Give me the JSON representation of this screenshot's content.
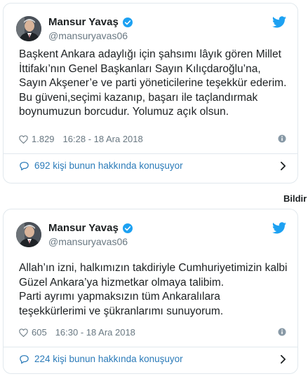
{
  "colors": {
    "accent": "#1da1f2",
    "link": "#2b7bb9",
    "muted": "#697882",
    "border": "#e1e8ed"
  },
  "icons": [
    "person-avatar",
    "verified-badge-icon",
    "twitter-bird-icon",
    "heart-icon",
    "info-icon",
    "speech-bubble-icon",
    "chevron-right-icon"
  ],
  "tweets": [
    {
      "name": "Mansur Yavaş",
      "handle": "@mansuryavas06",
      "lines": [
        "Başkent Ankara adaylığı için şahsımı lâyık gören Millet",
        "İttifakı’nın Genel Başkanları Sayın Kılıçdaroğlu’na,",
        "Sayın Akşener’e ve parti yöneticilerine teşekkür ederim.",
        "Bu güveni,seçimi kazanıp, başarı ile taçlandırmak",
        "boynumuzun borcudur.  Yolumuz açık olsun."
      ],
      "likes": "1.829",
      "time": "16:28 - 18 Ara 2018",
      "conversation": "692 kişi bunun hakkında konuşuyor"
    },
    {
      "name": "Mansur Yavaş",
      "handle": "@mansuryavas06",
      "lines": [
        "Allah’ın izni, halkımızın takdiriyle Cumhuriyetimizin kalbi",
        "Güzel Ankara’ya hizmetkar olmaya talibim.",
        "Parti ayrımı yapmaksızın tüm Ankaralılara",
        "teşekkürlerimi ve şükranlarımı sunuyorum."
      ],
      "likes": "605",
      "time": "16:30 - 18 Ara 2018",
      "conversation": "224 kişi bunun hakkında konuşuyor"
    }
  ],
  "report_label": "Bildir"
}
